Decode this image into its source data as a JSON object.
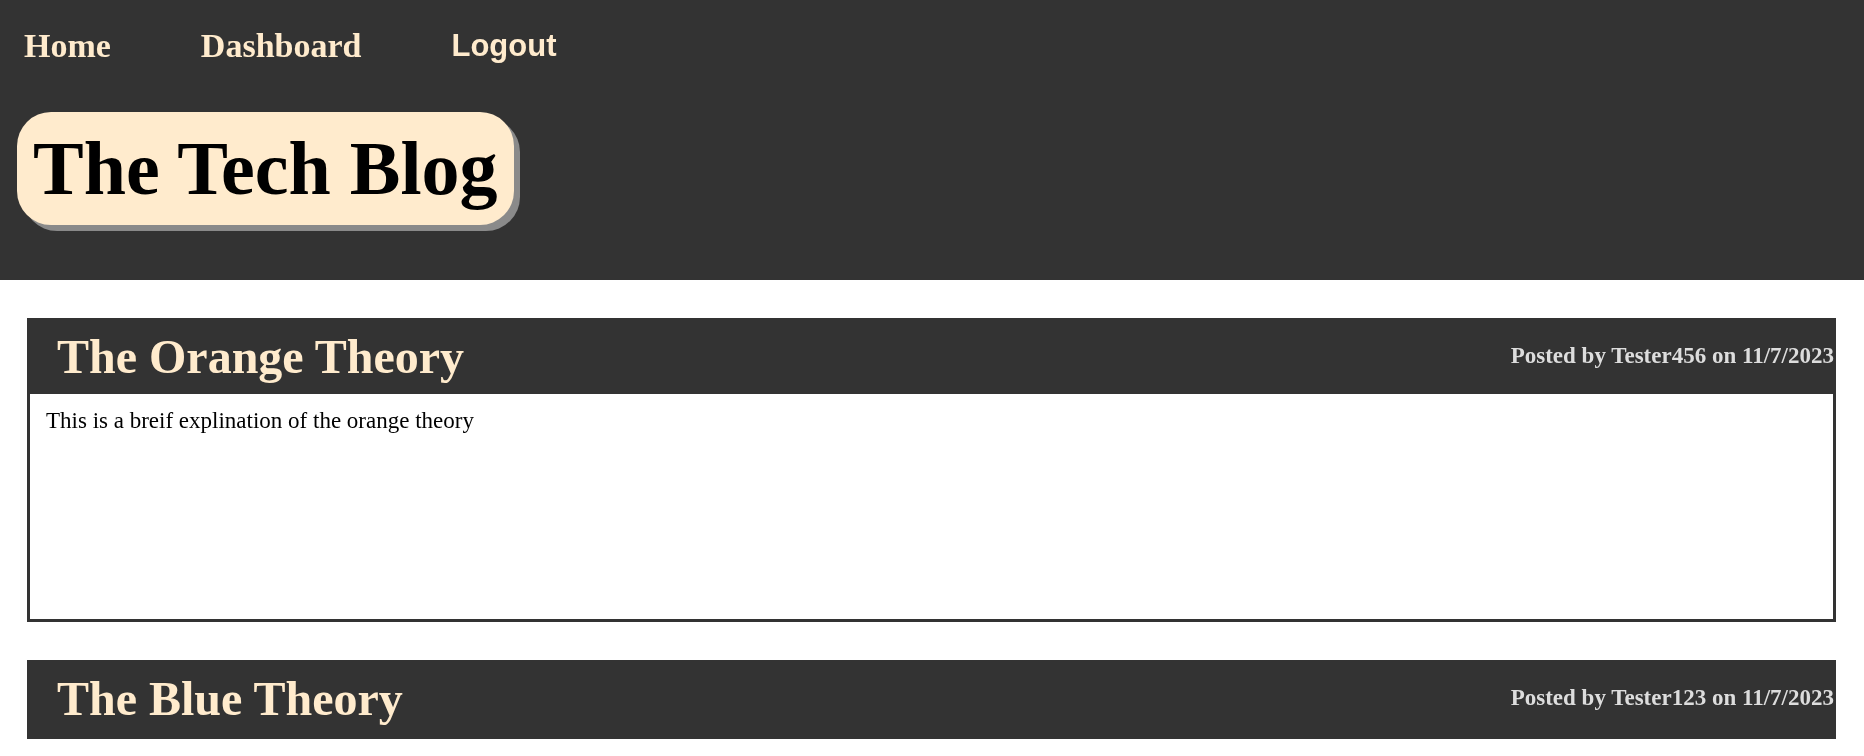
{
  "nav": [
    {
      "label": "Home",
      "kind": "link"
    },
    {
      "label": "Dashboard",
      "kind": "link"
    },
    {
      "label": "Logout",
      "kind": "button"
    }
  ],
  "site_title": "The Tech Blog",
  "posts": [
    {
      "title": "The Orange Theory",
      "meta": "Posted by Tester456 on 11/7/2023",
      "body": "This is a breif explination of the orange theory"
    },
    {
      "title": "The Blue Theory",
      "meta": "Posted by Tester123 on 11/7/2023"
    }
  ]
}
